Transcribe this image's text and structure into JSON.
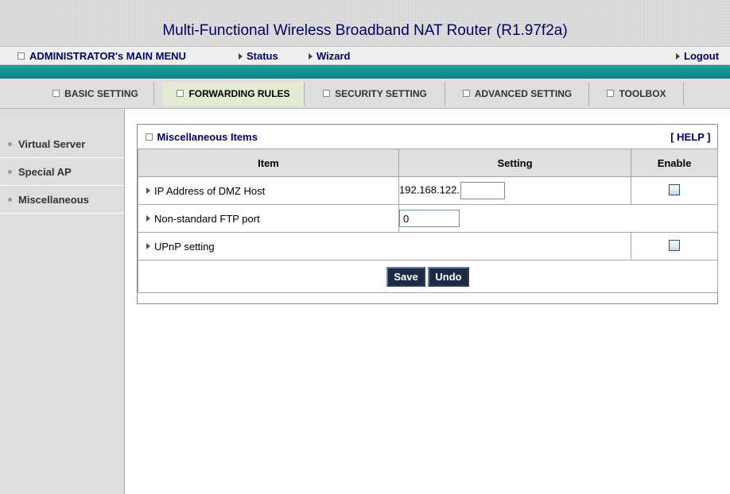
{
  "header": {
    "title": "Multi-Functional Wireless Broadband NAT Router (R1.97f2a)"
  },
  "menubar": {
    "main_menu": "ADMINISTRATOR's MAIN MENU",
    "status": "Status",
    "wizard": "Wizard",
    "logout": "Logout"
  },
  "tabs": [
    {
      "label": "BASIC SETTING",
      "active": false
    },
    {
      "label": "FORWARDING RULES",
      "active": true
    },
    {
      "label": "SECURITY SETTING",
      "active": false
    },
    {
      "label": "ADVANCED SETTING",
      "active": false
    },
    {
      "label": "TOOLBOX",
      "active": false
    }
  ],
  "sidebar": {
    "items": [
      {
        "label": "Virtual Server"
      },
      {
        "label": "Special AP"
      },
      {
        "label": "Miscellaneous"
      }
    ]
  },
  "panel": {
    "title": "Miscellaneous Items",
    "help": "[ HELP ]",
    "columns": {
      "item": "Item",
      "setting": "Setting",
      "enable": "Enable"
    },
    "rows": {
      "dmz": {
        "label": "IP Address of DMZ Host",
        "ip_prefix": "192.168.122.",
        "value": "",
        "enabled": false
      },
      "ftp": {
        "label": "Non-standard FTP port",
        "value": "0"
      },
      "upnp": {
        "label": "UPnP setting",
        "enabled": false
      }
    },
    "buttons": {
      "save": "Save",
      "undo": "Undo"
    }
  },
  "colors": {
    "accent_teal": "#0c7f84",
    "title_navy": "#000066",
    "button_navy": "#1b2a47",
    "active_tab": "#e3ecd2"
  }
}
